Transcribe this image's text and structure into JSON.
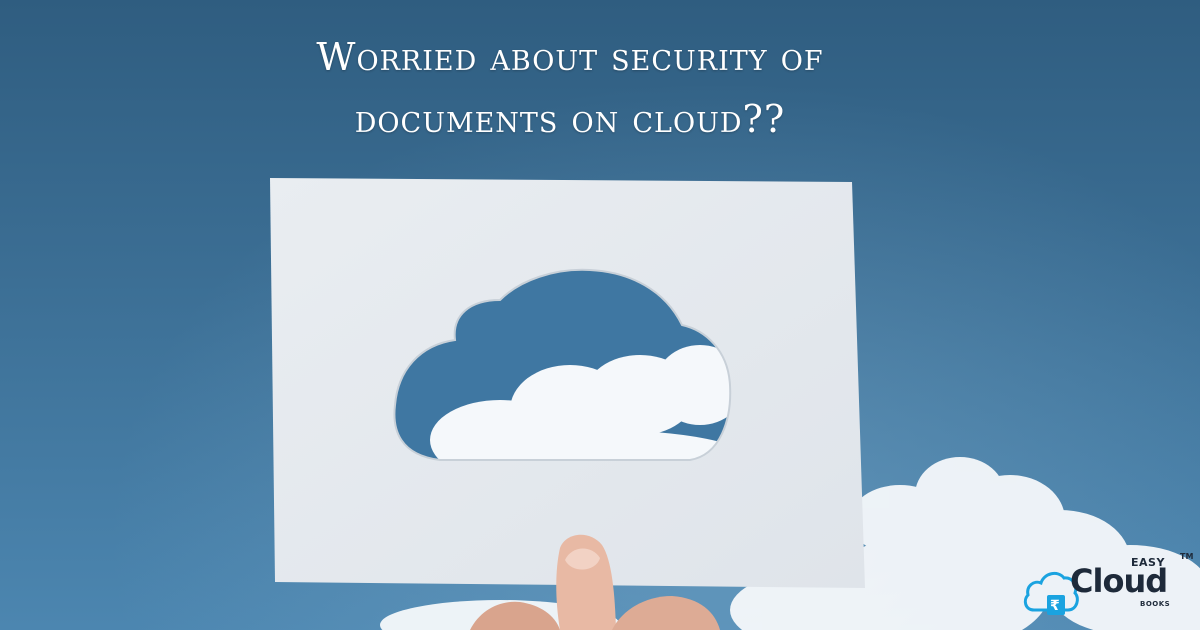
{
  "headline": {
    "line1": "Worried about security of",
    "line2": "documents on cloud??"
  },
  "logo": {
    "easy": "EASY",
    "cloud": "Cloud",
    "books": "BOOKS",
    "tm": "TM",
    "rupee": "₹"
  },
  "colors": {
    "sky_top": "#2f5d80",
    "sky_bottom": "#4c86b0",
    "paper": "#e6eaee",
    "cloud_white": "#f7f9fb",
    "logo_blue": "#1aa3e0"
  },
  "icons": [
    "cloud-cutout-icon",
    "rupee-icon",
    "cloud-logo-icon"
  ]
}
